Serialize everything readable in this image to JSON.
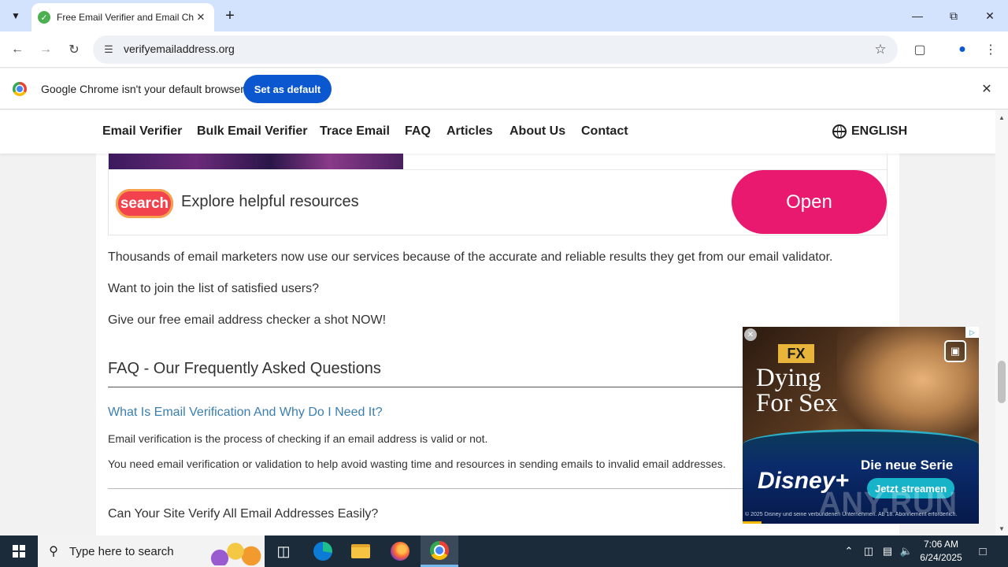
{
  "browser": {
    "tab_title": "Free Email Verifier and Email Ch",
    "url": "verifyemailaddress.org",
    "infobar_text": "Google Chrome isn't your default browser",
    "infobar_button": "Set as default"
  },
  "site_nav": {
    "items": [
      "Email Verifier",
      "Bulk Email Verifier",
      "Trace Email",
      "FAQ",
      "Articles",
      "About Us",
      "Contact"
    ],
    "language": "ENGLISH"
  },
  "ad_banner": {
    "logo_text": "search",
    "text": "Explore helpful resources",
    "button": "Open"
  },
  "content": {
    "paragraphs": [
      "Thousands of email marketers now use our services because of the accurate and reliable results they get from our email validator.",
      "Want to join the list of satisfied users?",
      "Give our free email address checker a shot NOW!"
    ],
    "faq_heading": "FAQ - Our Frequently Asked Questions",
    "faq": [
      {
        "question": "What Is Email Verification And Why Do I Need It?",
        "answers": [
          "Email verification is the process of checking if an email address is valid or not.",
          "You need email verification or validation to help avoid wasting time and resources in sending emails to invalid email addresses."
        ]
      },
      {
        "question": "Can Your Site Verify All Email Addresses Easily?"
      }
    ]
  },
  "video_ad": {
    "network_badge": "FX",
    "title_line1": "Dying",
    "title_line2": "For Sex",
    "brand": "Disney+",
    "headline": "Die neue Serie",
    "cta": "Jetzt streamen",
    "copyright": "© 2025 Disney und seine verbundenen Unternehmen. Ab 18. Abonnement erforderlich.",
    "progress_fraction": 0.08
  },
  "watermark": "ANY.RUN",
  "taskbar": {
    "search_placeholder": "Type here to search",
    "time": "7:06 AM",
    "date": "6/24/2025"
  },
  "icons": {
    "tab_favicon": "check-icon",
    "back": "back-arrow-icon",
    "forward": "forward-arrow-icon",
    "reload": "reload-icon",
    "site_info": "tune-icon",
    "bookmark": "star-icon",
    "extensions": "puzzle-icon",
    "profile": "person-icon",
    "menu": "kebab-icon",
    "language": "globe-icon"
  },
  "colors": {
    "tab_strip": "#d3e3fd",
    "set_default_button": "#0b57d0",
    "open_button": "#e8196f",
    "faq_link": "#3a7fb0",
    "taskbar": "#1c2b3a"
  }
}
